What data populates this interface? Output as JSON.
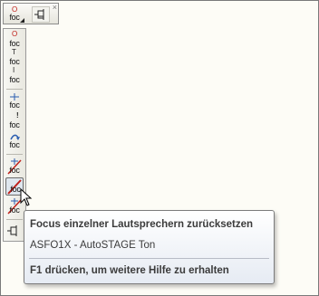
{
  "toolbar": {
    "focus_tool_label": "foc",
    "close_glyph": "×"
  },
  "side_tools": [
    {
      "label": "foc",
      "mark": "O",
      "icon": "focus-circle-icon"
    },
    {
      "label": "foc",
      "mark": "T",
      "icon": "focus-top-icon"
    },
    {
      "label": "foc",
      "mark": "I",
      "icon": "focus-vertical-icon"
    },
    {
      "label": "foc",
      "mark": "+",
      "icon": "focus-cross-icon"
    },
    {
      "label": "foc",
      "mark": "!",
      "icon": "focus-line-icon"
    },
    {
      "label": "foc",
      "mark": "↷",
      "icon": "focus-rotate-icon"
    },
    {
      "label": "foc",
      "mark": "+",
      "icon": "focus-cross-strike-icon"
    },
    {
      "label": "foc",
      "mark": "/",
      "icon": "focus-reset-icon"
    },
    {
      "label": "foc",
      "mark": "+",
      "icon": "focus-cross-red-icon"
    }
  ],
  "tooltip": {
    "title": "Focus einzelner Lautsprechern zurücksetzen",
    "body": "ASFO1X - AutoSTAGE Ton",
    "help": "F1 drücken, um weitere Hilfe zu erhalten"
  },
  "colors": {
    "accent_red": "#c0201a",
    "accent_blue": "#2a5db0"
  }
}
